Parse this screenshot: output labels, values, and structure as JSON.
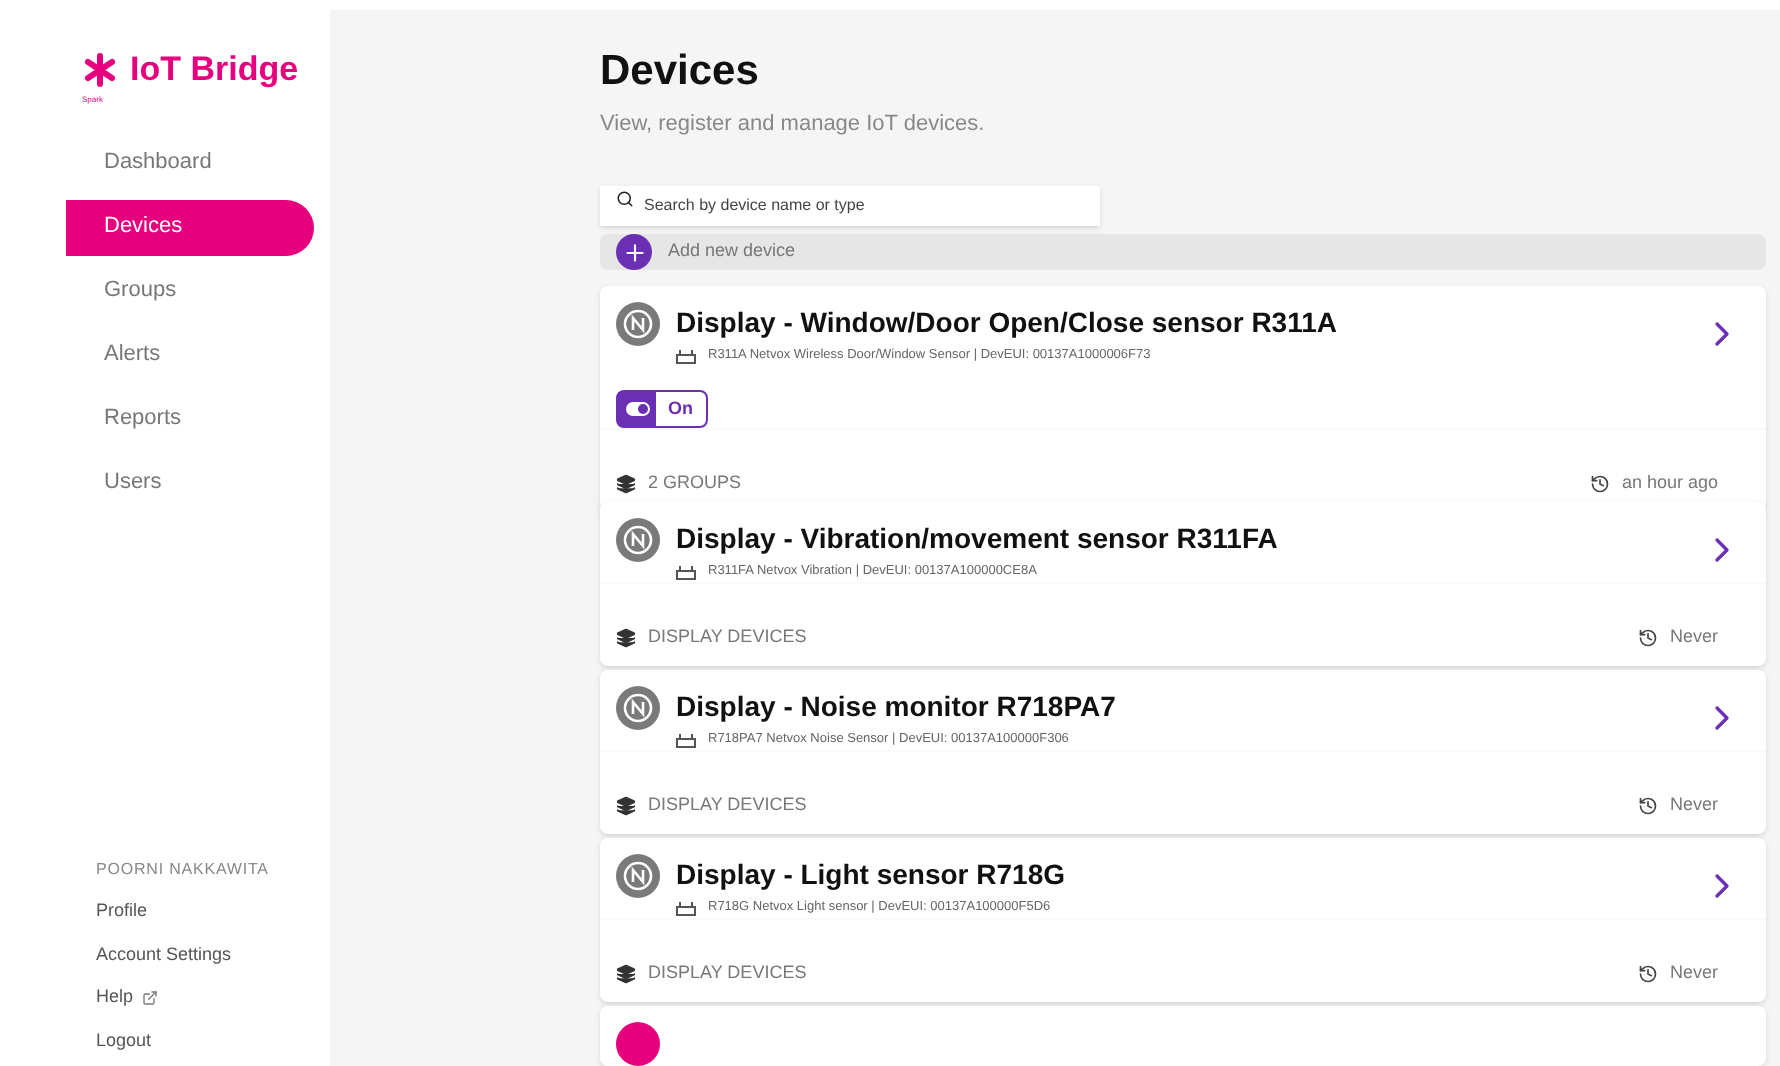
{
  "brand": {
    "name": "IoT Bridge",
    "tagline": "Spark"
  },
  "nav": [
    {
      "label": "Dashboard",
      "selected": false
    },
    {
      "label": "Devices",
      "selected": true
    },
    {
      "label": "Groups",
      "selected": false
    },
    {
      "label": "Alerts",
      "selected": false
    },
    {
      "label": "Reports",
      "selected": false
    },
    {
      "label": "Users",
      "selected": false
    }
  ],
  "account": {
    "user": "POORNI NAKKAWITA",
    "links": [
      {
        "label": "Profile",
        "external": false
      },
      {
        "label": "Account Settings",
        "external": false
      },
      {
        "label": "Help",
        "external": true
      },
      {
        "label": "Logout",
        "external": false
      }
    ]
  },
  "page": {
    "title": "Devices",
    "subtitle": "View, register and manage IoT devices."
  },
  "search": {
    "placeholder": "Search by device name or type"
  },
  "add_button": "Add new device",
  "devices": [
    {
      "name": "Display - Window/Door Open/Close sensor R311A",
      "detail": "R311A Netvox Wireless Door/Window Sensor | DevEUI: 00137A1000006F73",
      "toggle": {
        "on": true,
        "label": "On"
      },
      "groups": "2 GROUPS",
      "last_seen": "an hour ago"
    },
    {
      "name": "Display - Vibration/movement sensor R311FA",
      "detail": "R311FA Netvox Vibration | DevEUI: 00137A100000CE8A",
      "groups": "DISPLAY DEVICES",
      "last_seen": "Never"
    },
    {
      "name": "Display - Noise monitor R718PA7",
      "detail": "R718PA7 Netvox Noise Sensor | DevEUI: 00137A100000F306",
      "groups": "DISPLAY DEVICES",
      "last_seen": "Never"
    },
    {
      "name": "Display - Light sensor R718G",
      "detail": "R718G Netvox Light sensor | DevEUI: 00137A100000F5D6",
      "groups": "DISPLAY DEVICES",
      "last_seen": "Never"
    }
  ]
}
